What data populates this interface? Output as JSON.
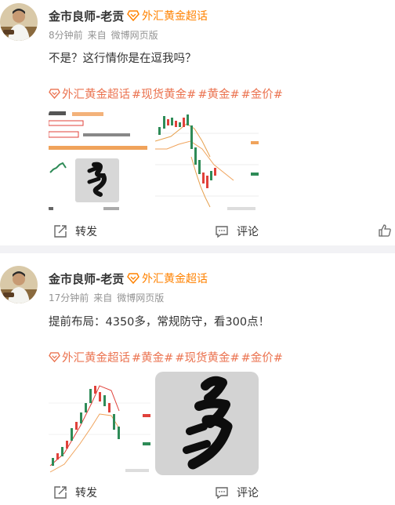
{
  "posts": [
    {
      "author": "金市良师-老贡",
      "chaohua": "外汇黄金超话",
      "time": "8分钟前",
      "source_prefix": "来自",
      "source": "微博网页版",
      "text": "不是？这行情你是在逗我吗？",
      "tags": [
        "外汇黄金超话",
        "#现货黄金#",
        "#黄金#",
        "#金价#"
      ],
      "repost_label": "转发",
      "comment_label": "评论"
    },
    {
      "author": "金市良师-老贡",
      "chaohua": "外汇黄金超话",
      "time": "17分钟前",
      "source_prefix": "来自",
      "source": "微博网页版",
      "text": "提前布局：4350多，常规防守，看300点！",
      "tags": [
        "外汇黄金超话",
        "#黄金#",
        "#现货黄金#",
        "#金价#"
      ],
      "repost_label": "转发",
      "comment_label": "评论"
    }
  ],
  "colors": {
    "chaohua": "#ff8200",
    "tag": "#eb7350",
    "meta": "#939393",
    "up": "#2e8b57",
    "down": "#e0413a"
  }
}
